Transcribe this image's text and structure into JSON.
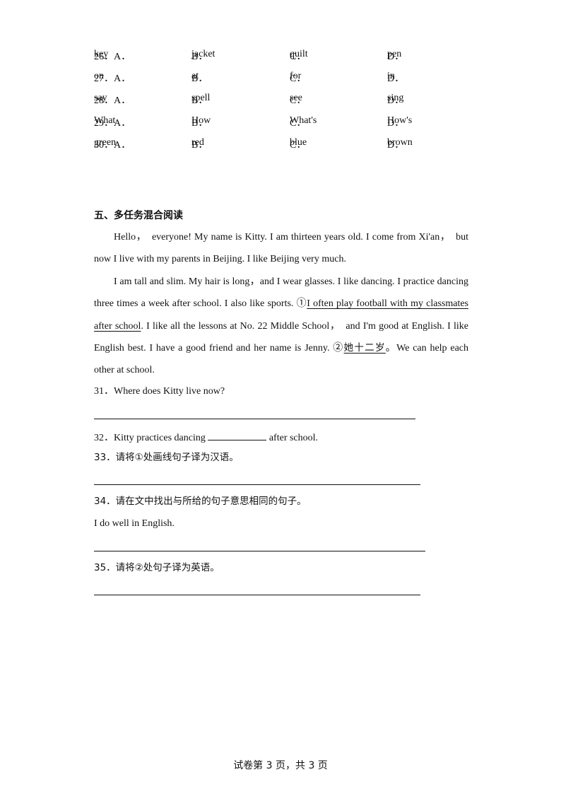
{
  "choice_questions": [
    {
      "prefix": "26．A．",
      "a": "key",
      "b_label": "B．",
      "b": "jacket",
      "c_label": "C．",
      "c": "quilt",
      "d_label": "D．",
      "d": "pen"
    },
    {
      "prefix": "27．A．",
      "a": "on",
      "b_label": "B．",
      "b": "at",
      "c_label": "C．",
      "c": "for",
      "d_label": "D．",
      "d": "in"
    },
    {
      "prefix": "28．A．",
      "a": "say",
      "b_label": "B．",
      "b": "spell",
      "c_label": "C．",
      "c": "see",
      "d_label": "D．",
      "d": "sing"
    },
    {
      "prefix": "29．A．",
      "a": "What",
      "b_label": "B．",
      "b": "How",
      "c_label": "C．",
      "c": "What's",
      "d_label": "D．",
      "d": "How's"
    },
    {
      "prefix": "30．A．",
      "a": "green",
      "b_label": "B．",
      "b": "red",
      "c_label": "C．",
      "c": "blue",
      "d_label": "D．",
      "d": "brown"
    }
  ],
  "section": {
    "title": "五、多任务混合阅读",
    "passage": {
      "p1": "Hello，　everyone! My name is Kitty. I am thirteen years old. I come from Xi'an，　but now I live with my parents in Beijing. I like Beijing very much.",
      "p2_a": "I am tall and slim. My hair is long，and I wear glasses. I like dancing. I practice dancing three times a week after school. I also like sports. ",
      "mark1": "①",
      "underline1": "I often play football with my classmates after school",
      "p2_b": ". I like all the lessons at No. 22 Middle School，　and I'm good at English. I like English best. I have a good friend and her name is Jenny. ",
      "mark2": "②",
      "underline2": "她十二岁",
      "p2_c": "。We can help each other at school."
    }
  },
  "questions": {
    "q31": "31．Where does Kitty live now?",
    "q32_before": "32．Kitty practices dancing ",
    "q32_after": " after school.",
    "q33": "33．请将①处画线句子译为汉语。",
    "q34": "34．请在文中找出与所给的句子意思相同的句子。",
    "q34_given": "I do well in English.",
    "q35": "35．请将②处句子译为英语。"
  },
  "footer": {
    "text": "试卷第 3 页，共 3 页"
  }
}
